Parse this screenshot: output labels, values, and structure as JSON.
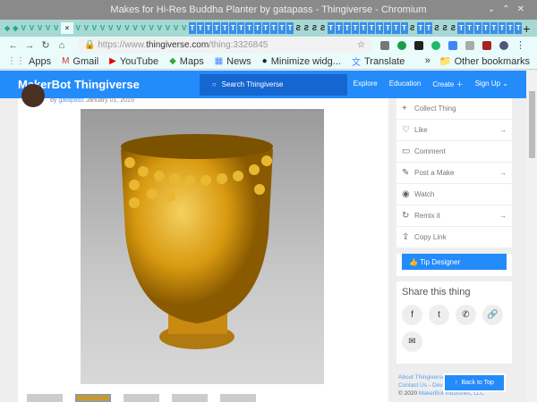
{
  "window": {
    "title": "Makes for Hi-Res Buddha Planter by gatapass - Thingiverse - Chromium"
  },
  "browser": {
    "url_host": "https://www.",
    "url_domain": "thingiverse.com",
    "url_path": "/thing:3326845"
  },
  "bookmarks": [
    {
      "icon": "apps-icon",
      "label": "Apps"
    },
    {
      "icon": "gmail-icon",
      "label": "Gmail"
    },
    {
      "icon": "youtube-icon",
      "label": "YouTube"
    },
    {
      "icon": "maps-icon",
      "label": "Maps"
    },
    {
      "icon": "news-icon",
      "label": "News"
    },
    {
      "icon": "globe-icon",
      "label": "Minimize widg..."
    },
    {
      "icon": "translate-icon",
      "label": "Translate"
    }
  ],
  "other_bookmarks": "Other bookmarks",
  "site": {
    "logo": "MakerBot Thingiverse",
    "search_placeholder": "Search Thingiverse",
    "menu": [
      "Explore",
      "Education",
      "Create",
      "Sign Up"
    ]
  },
  "thing": {
    "by": "by",
    "author": "gatapass",
    "date": "January 01, 2019"
  },
  "actions": [
    {
      "label": "Collect Thing",
      "icon": "+"
    },
    {
      "label": "Like",
      "icon": "♡",
      "arrow": true
    },
    {
      "label": "Comment",
      "icon": "▭"
    },
    {
      "label": "Post a Make",
      "icon": "✎",
      "arrow": true
    },
    {
      "label": "Watch",
      "icon": "◉"
    },
    {
      "label": "Remix it",
      "icon": "↻",
      "arrow": true
    },
    {
      "label": "Copy Link",
      "icon": "⇪"
    }
  ],
  "tip": "Tip Designer",
  "share": {
    "title": "Share this thing",
    "buttons": [
      "f",
      "t",
      "✆",
      "🔗",
      "✉"
    ]
  },
  "footer": {
    "about": "About Thingiverse ®",
    "contact": "Contact Us",
    "dev": "Devel",
    "copy": "© 2020",
    "maker": "MakerBot Industries, LLC"
  },
  "back_to_top": "Back to Top"
}
